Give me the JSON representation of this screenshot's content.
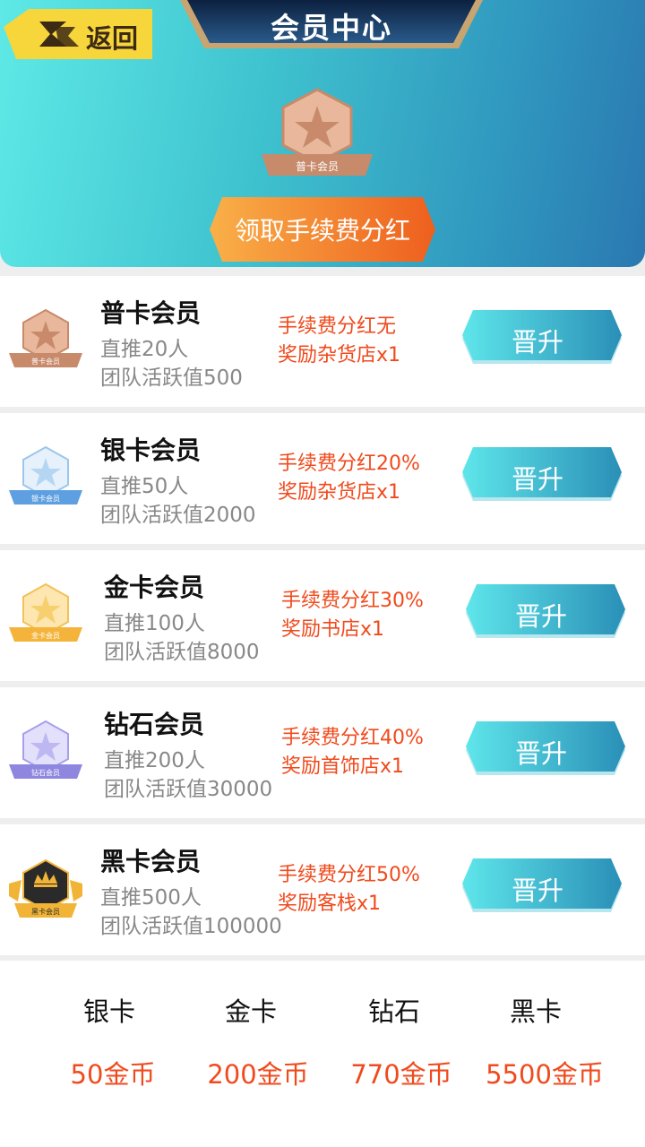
{
  "header": {
    "title": "会员中心",
    "back_label": "返回",
    "current_badge_label": "普卡会员",
    "claim_label": "领取手续费分红"
  },
  "tiers": [
    {
      "name": "普卡会员",
      "badge_label": "普卡会员",
      "req_direct": "直推20人",
      "req_team": "团队活跃值500",
      "benefit1": "手续费分红无",
      "benefit2": "奖励杂货店x1",
      "button": "晋升",
      "color": "#d59a7c"
    },
    {
      "name": "银卡会员",
      "badge_label": "银卡会员",
      "req_direct": "直推50人",
      "req_team": "团队活跃值2000",
      "benefit1": "手续费分红20%",
      "benefit2": "奖励杂货店x1",
      "button": "晋升",
      "color": "#7fb6e6"
    },
    {
      "name": "金卡会员",
      "badge_label": "金卡会员",
      "req_direct": "直推100人",
      "req_team": "团队活跃值8000",
      "benefit1": "手续费分红30%",
      "benefit2": "奖励书店x1",
      "button": "晋升",
      "color": "#f6be52"
    },
    {
      "name": "钻石会员",
      "badge_label": "钻石会员",
      "req_direct": "直推200人",
      "req_team": "团队活跃值30000",
      "benefit1": "手续费分红40%",
      "benefit2": "奖励首饰店x1",
      "button": "晋升",
      "color": "#9b92e6"
    },
    {
      "name": "黑卡会员",
      "badge_label": "黑卡会员",
      "req_direct": "直推500人",
      "req_team": "团队活跃值100000",
      "benefit1": "手续费分红50%",
      "benefit2": "奖励客栈x1",
      "button": "晋升",
      "color": "#2a2a2a"
    }
  ],
  "prices": [
    {
      "name": "银卡",
      "price": "50金币"
    },
    {
      "name": "金卡",
      "price": "200金币"
    },
    {
      "name": "钻石",
      "price": "770金币"
    },
    {
      "name": "黑卡",
      "price": "5500金币"
    }
  ],
  "colors": {
    "accent_orange": "#f04a1c",
    "header_gradient_start": "#5ee9e6",
    "header_gradient_end": "#2a78b0",
    "button_gradient_start": "#5ee6ea",
    "button_gradient_end": "#2a8fb7"
  }
}
